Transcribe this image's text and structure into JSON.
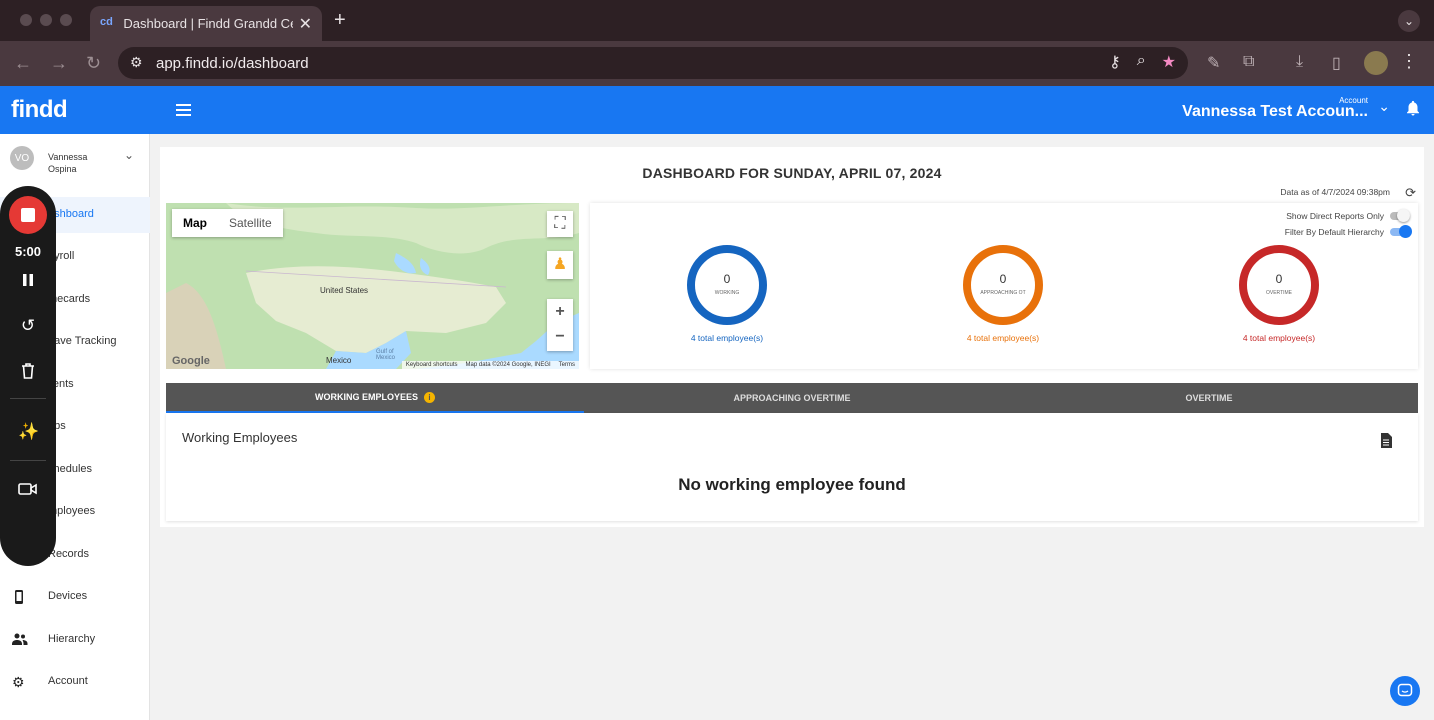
{
  "browser": {
    "tab_title": "Dashboard | Findd Grandd Ce",
    "favicon_text": "cd",
    "url": "app.findd.io/dashboard"
  },
  "header": {
    "logo": "findd",
    "account_small_label": "Account",
    "account_name": "Vannessa Test Accoun..."
  },
  "sidebar": {
    "user_initials": "VO",
    "user_name": "Vannessa Ospina",
    "items": [
      {
        "label": "ashboard",
        "icon": "dashboard-icon"
      },
      {
        "label": "ayroll",
        "icon": "payroll-icon"
      },
      {
        "label": "mecards",
        "icon": "timecards-icon"
      },
      {
        "label": "eave Tracking",
        "icon": "leave-icon"
      },
      {
        "label": "lients",
        "icon": "clients-icon"
      },
      {
        "label": "obs",
        "icon": "jobs-icon"
      },
      {
        "label": "chedules",
        "icon": "schedules-icon"
      },
      {
        "label": "mployees",
        "icon": "employees-icon"
      },
      {
        "label": "Records",
        "icon": "records-icon"
      },
      {
        "label": "Devices",
        "icon": "phone-icon"
      },
      {
        "label": "Hierarchy",
        "icon": "people-icon"
      },
      {
        "label": "Account",
        "icon": "gear-icon"
      }
    ]
  },
  "recorder": {
    "time": "5:00"
  },
  "dashboard": {
    "title": "DASHBOARD FOR SUNDAY, APRIL 07, 2024",
    "data_as_of": "Data as of 4/7/2024 09:38pm",
    "map": {
      "map_label": "Map",
      "satellite_label": "Satellite",
      "labels": {
        "us": "United States",
        "mexico": "Mexico",
        "gulf": "Gulf of Mexico"
      },
      "footer": [
        "Keyboard shortcuts",
        "Map data ©2024 Google, INEGI",
        "Terms"
      ],
      "google": "Google"
    },
    "toggles": {
      "direct_reports": "Show Direct Reports Only",
      "default_hierarchy": "Filter By Default Hierarchy"
    },
    "stats": [
      {
        "value": "0",
        "label": "WORKING",
        "total": "4 total employee(s)",
        "color": "#1565c0"
      },
      {
        "value": "0",
        "label": "APPROACHING OT",
        "total": "4 total employee(s)",
        "color": "#e8710a"
      },
      {
        "value": "0",
        "label": "OVERTIME",
        "total": "4 total employee(s)",
        "color": "#c62828"
      }
    ],
    "tabs": [
      "WORKING EMPLOYEES",
      "APPROACHING OVERTIME",
      "OVERTIME"
    ],
    "panel_title": "Working Employees",
    "empty_message": "No working employee found"
  }
}
